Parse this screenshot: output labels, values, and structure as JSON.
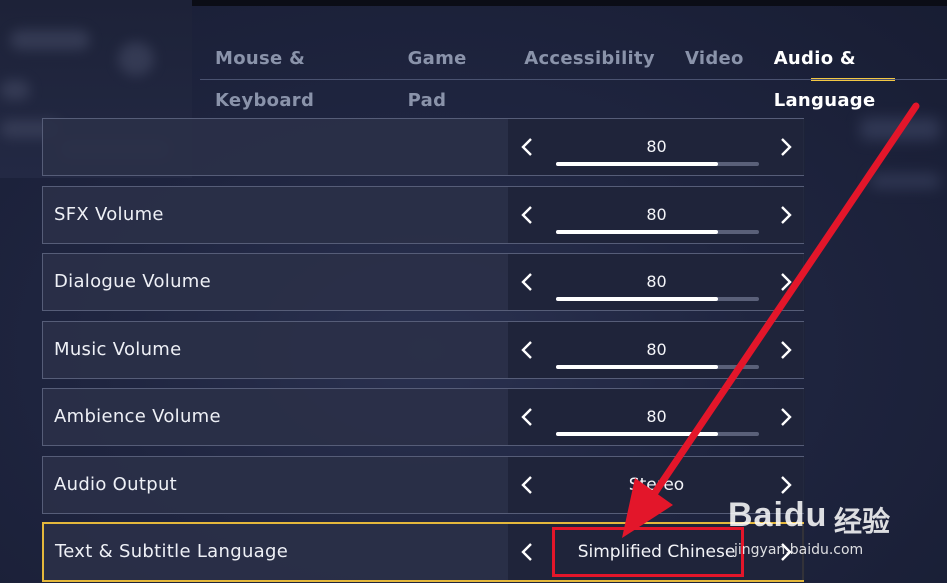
{
  "tabs": {
    "mouse_keyboard": "Mouse & Keyboard",
    "game_pad": "Game Pad",
    "accessibility": "Accessibility",
    "video": "Video",
    "audio_language": "Audio & Language",
    "active": "audio_language"
  },
  "settings": [
    {
      "label": "",
      "value": "80",
      "level": 0.8
    },
    {
      "label": "SFX Volume",
      "value": "80",
      "level": 0.8
    },
    {
      "label": "Dialogue Volume",
      "value": "80",
      "level": 0.8
    },
    {
      "label": "Music Volume",
      "value": "80",
      "level": 0.8
    },
    {
      "label": "Ambience Volume",
      "value": "80",
      "level": 0.8
    },
    {
      "label": "Audio Output",
      "value": "Stereo"
    },
    {
      "label": "Text & Subtitle Language",
      "value": "Simplified Chinese"
    }
  ],
  "watermark": {
    "brand": "Baidu",
    "cn": "经验",
    "url": "jingyan.baidu.com"
  },
  "colors": {
    "accent": "#f2c744",
    "selected_border": "#e4b83c",
    "annotation": "#e3162a"
  },
  "icons": {
    "prev": "chevron-left-icon",
    "next": "chevron-right-icon"
  }
}
